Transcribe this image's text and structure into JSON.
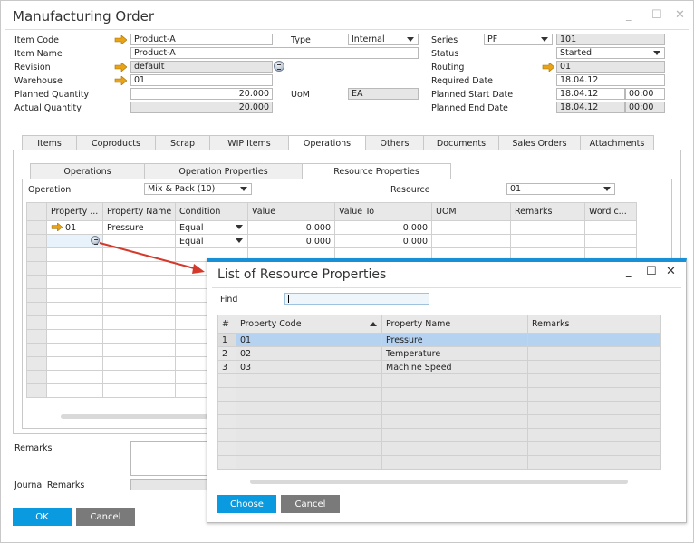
{
  "window": {
    "title": "Manufacturing Order",
    "controls": {
      "minimize": "_",
      "maximize": "☐",
      "close": "✕"
    }
  },
  "header": {
    "item_code": {
      "label": "Item Code",
      "value": "Product-A"
    },
    "item_name": {
      "label": "Item Name",
      "value": "Product-A"
    },
    "revision": {
      "label": "Revision",
      "value": "default"
    },
    "warehouse": {
      "label": "Warehouse",
      "value": "01"
    },
    "planned_quantity": {
      "label": "Planned Quantity",
      "value": "20.000"
    },
    "actual_quantity": {
      "label": "Actual Quantity",
      "value": "20.000"
    },
    "type": {
      "label": "Type",
      "value": "Internal"
    },
    "uom": {
      "label": "UoM",
      "value": "EA"
    },
    "series": {
      "label": "Series",
      "value": "PF",
      "number": "101"
    },
    "status": {
      "label": "Status",
      "value": "Started"
    },
    "routing": {
      "label": "Routing",
      "value": "01"
    },
    "required_date": {
      "label": "Required Date",
      "value": "18.04.12"
    },
    "planned_start_date": {
      "label": "Planned Start Date",
      "value": "18.04.12",
      "time": "00:00"
    },
    "planned_end_date": {
      "label": "Planned End Date",
      "value": "18.04.12",
      "time": "00:00"
    }
  },
  "tabs": [
    {
      "label": "Items"
    },
    {
      "label": "Coproducts"
    },
    {
      "label": "Scrap"
    },
    {
      "label": "WIP Items"
    },
    {
      "label": "Operations",
      "active": true
    },
    {
      "label": "Others"
    },
    {
      "label": "Documents"
    },
    {
      "label": "Sales Orders"
    },
    {
      "label": "Attachments"
    }
  ],
  "subtabs": [
    {
      "label": "Operations"
    },
    {
      "label": "Operation Properties"
    },
    {
      "label": "Resource Properties",
      "active": true
    }
  ],
  "operation": {
    "label": "Operation",
    "value": "Mix & Pack (10)"
  },
  "resource": {
    "label": "Resource",
    "value": "01"
  },
  "properties_grid": {
    "columns": [
      "Property ...",
      "Property Name",
      "Condition",
      "Value",
      "Value To",
      "UOM",
      "Remarks",
      "Word c..."
    ],
    "rows": [
      {
        "code": "01",
        "name": "Pressure",
        "condition": "Equal",
        "value": "0.000",
        "value_to": "0.000",
        "uom": "",
        "remarks": "",
        "word": ""
      },
      {
        "code": "",
        "name": "",
        "condition": "Equal",
        "value": "0.000",
        "value_to": "0.000",
        "uom": "",
        "remarks": "",
        "word": ""
      }
    ]
  },
  "footer": {
    "remarks_label": "Remarks",
    "remarks_value": "",
    "journal_remarks_label": "Journal Remarks",
    "journal_remarks_value": "",
    "ok_label": "OK",
    "cancel_label": "Cancel"
  },
  "dialog": {
    "title": "List of Resource Properties",
    "find_label": "Find",
    "find_value": "",
    "columns": [
      "#",
      "Property Code",
      "Property Name",
      "Remarks"
    ],
    "rows": [
      {
        "num": "1",
        "code": "01",
        "name": "Pressure",
        "remarks": ""
      },
      {
        "num": "2",
        "code": "02",
        "name": "Temperature",
        "remarks": ""
      },
      {
        "num": "3",
        "code": "03",
        "name": "Machine Speed",
        "remarks": ""
      }
    ],
    "selected_row": 1,
    "choose_label": "Choose",
    "cancel_label": "Cancel"
  },
  "colors": {
    "accent_blue": "#0a9ae0",
    "dialog_border": "#1890d8",
    "selection": "#b5d3f1",
    "link_arrow": "#e8a317",
    "callout_arrow": "#d33a2c"
  }
}
